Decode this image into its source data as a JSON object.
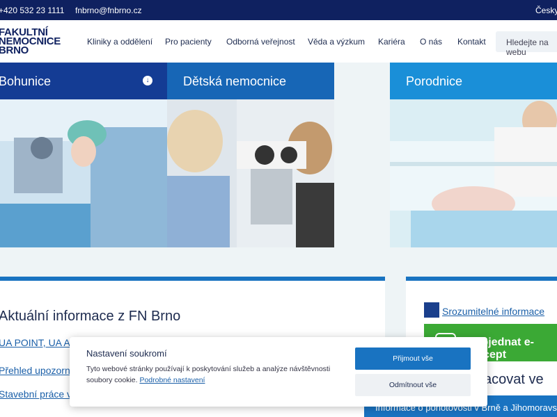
{
  "topbar": {
    "phone": "+420 532 23 1111",
    "email": "fnbrno@fnbrno.cz",
    "language": "Česky"
  },
  "header": {
    "logo_lines": [
      "FAKULTNÍ",
      "NEMOCNICE",
      "BRNO"
    ],
    "nav": [
      "Kliniky a oddělení",
      "Pro pacienty",
      "Odborná veřejnost",
      "Věda a výzkum",
      "Kariéra",
      "O nás",
      "Kontakt"
    ],
    "search_placeholder": "Hledejte na webu"
  },
  "tiles": [
    {
      "title": "Bohunice",
      "color": "#143c94"
    },
    {
      "title": "Dětská nemocnice",
      "color": "#1766b6"
    },
    {
      "title": "Porodnice",
      "color": "#1a8fd8"
    }
  ],
  "news": {
    "heading": "Aktuální informace z FN Brno",
    "links": [
      "UA POINT, UA Ambulance",
      "Přehled upozornění",
      "Stavební práce v areálu"
    ]
  },
  "side": {
    "srozumitelne": "Srozumitelné informace",
    "objednat": "Objednat e-recept",
    "pracovat": "Pracovat ve",
    "band": "Informace o pohotovosti v Brně a Jihomoravském kraji"
  },
  "cookie": {
    "title": "Nastavení soukromí",
    "text": "Tyto webové stránky používají k poskytování služeb a analýze návštěvnosti soubory cookie.",
    "settings_link": "Podrobné nastavení",
    "accept": "Přijmout vše",
    "reject": "Odmítnout vše"
  },
  "colors": {
    "topbar": "#0f2160",
    "accent": "#1973c1",
    "green": "#3ba935"
  }
}
